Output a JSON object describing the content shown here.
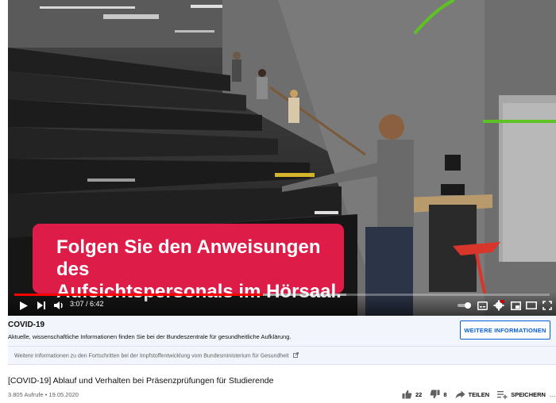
{
  "player": {
    "caption_line1": "Folgen Sie den Anweisungen des",
    "caption_line2": "Aufsichtspersonals im Hörsaal.",
    "time_display": "3:07 / 6:42",
    "progress_played": 0.465,
    "progress_loaded": 0.62,
    "caption_color": "#dd1c47",
    "progress_color": "#ff0000",
    "icons": [
      "play-icon",
      "next-icon",
      "volume-icon",
      "autoplay-toggle-icon",
      "subtitles-icon",
      "settings-icon",
      "miniplayer-icon",
      "theater-mode-icon",
      "fullscreen-icon"
    ]
  },
  "info_card": {
    "title": "COVID-19",
    "text": "Aktuelle, wissenschaftliche Informationen finden Sie bei der Bundeszentrale für gesundheitliche Aufklärung.",
    "button_label": "WEITERE INFORMATIONEN",
    "more_link": "Weitere Informationen zu den Fortschritten bei der Impfstoffentwicklung vom Bundesministerium für Gesundheit",
    "accent_color": "#065fd4"
  },
  "video": {
    "title": "[COVID-19] Ablauf und Verhalten bei Präsenzprüfungen für Studierende",
    "meta": "3.805 Aufrufe • 19.05.2020",
    "likes": "22",
    "dislikes": "8",
    "share_label": "TEILEN",
    "save_label": "SPEICHERN",
    "more_label": "..."
  }
}
